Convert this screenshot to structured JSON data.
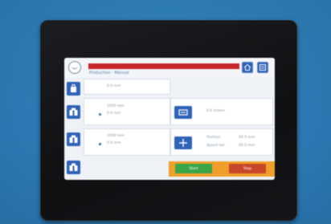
{
  "colors": {
    "wall": "#2e84c2",
    "bezel": "#141518",
    "alarm": "#c8252b",
    "button_blue": "#2f63b8",
    "accept_green": "#3aa548",
    "cancel_red": "#c8462a",
    "strip_orange": "#f0a02a"
  },
  "header": {
    "logo_icon": "logo-icon",
    "subtitle": "Production · Manual",
    "buttons": [
      {
        "icon": "home-icon"
      },
      {
        "icon": "menu-icon"
      }
    ]
  },
  "sidebar": {
    "buttons": [
      {
        "icon": "bag-icon"
      },
      {
        "icon": "tank-icon"
      },
      {
        "icon": "tank-icon"
      },
      {
        "icon": "tank-icon"
      }
    ]
  },
  "left_panel": {
    "row1": {
      "value": "0.0 mm"
    },
    "row2": {
      "label": "1000 mm",
      "value": "0.0 mm"
    },
    "row3": {
      "label": "1000 mm",
      "value": "0.0 mm"
    }
  },
  "right_panel": {
    "row1": {
      "icon": "transfer-icon",
      "value": "0.0 m/min"
    },
    "row2": {
      "icon": "split-icon",
      "line1_label": "Position",
      "line1_value": "00.0 mm",
      "line2_label": "Speed set",
      "line2_value": "00.0 mm"
    }
  },
  "actions": {
    "accept_label": "Start",
    "cancel_label": "Stop"
  }
}
